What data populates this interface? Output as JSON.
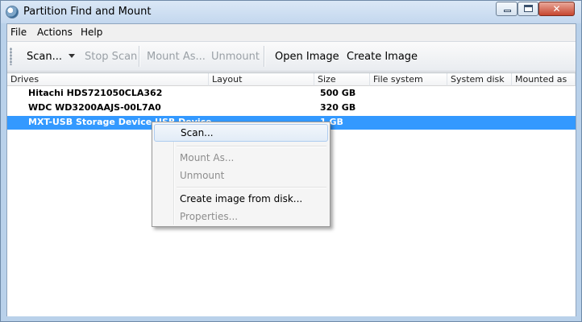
{
  "window": {
    "title": "Partition Find and Mount",
    "close_glyph": "✕"
  },
  "menu": {
    "file": "File",
    "actions": "Actions",
    "help": "Help"
  },
  "toolbar": {
    "scan": "Scan...",
    "stop_scan": "Stop Scan",
    "mount_as": "Mount As...",
    "unmount": "Unmount",
    "open_image": "Open Image",
    "create_image": "Create Image"
  },
  "columns": [
    "Drives",
    "Layout",
    "Size",
    "File system",
    "System disk",
    "Mounted as"
  ],
  "drives": [
    {
      "name": "Hitachi HDS721050CLA362",
      "size": "500 GB",
      "selected": false
    },
    {
      "name": "WDC WD3200AAJS-00L7A0",
      "size": "320 GB",
      "selected": false
    },
    {
      "name": "MXT-USB Storage Device USB Device",
      "size": "1 GB",
      "selected": true
    }
  ],
  "context_menu": {
    "scan": "Scan...",
    "mount_as": "Mount As...",
    "unmount": "Unmount",
    "create_image_from_disk": "Create image from disk...",
    "properties": "Properties..."
  },
  "colors": {
    "selection": "#3399ff",
    "title_gradient_top": "#dbe8f6",
    "close_button": "#c7462f"
  },
  "icons": {
    "app": "disk-icon",
    "minimize": "minimize-icon",
    "maximize": "maximize-icon",
    "close": "close-icon",
    "dropdown": "chevron-down-icon"
  }
}
